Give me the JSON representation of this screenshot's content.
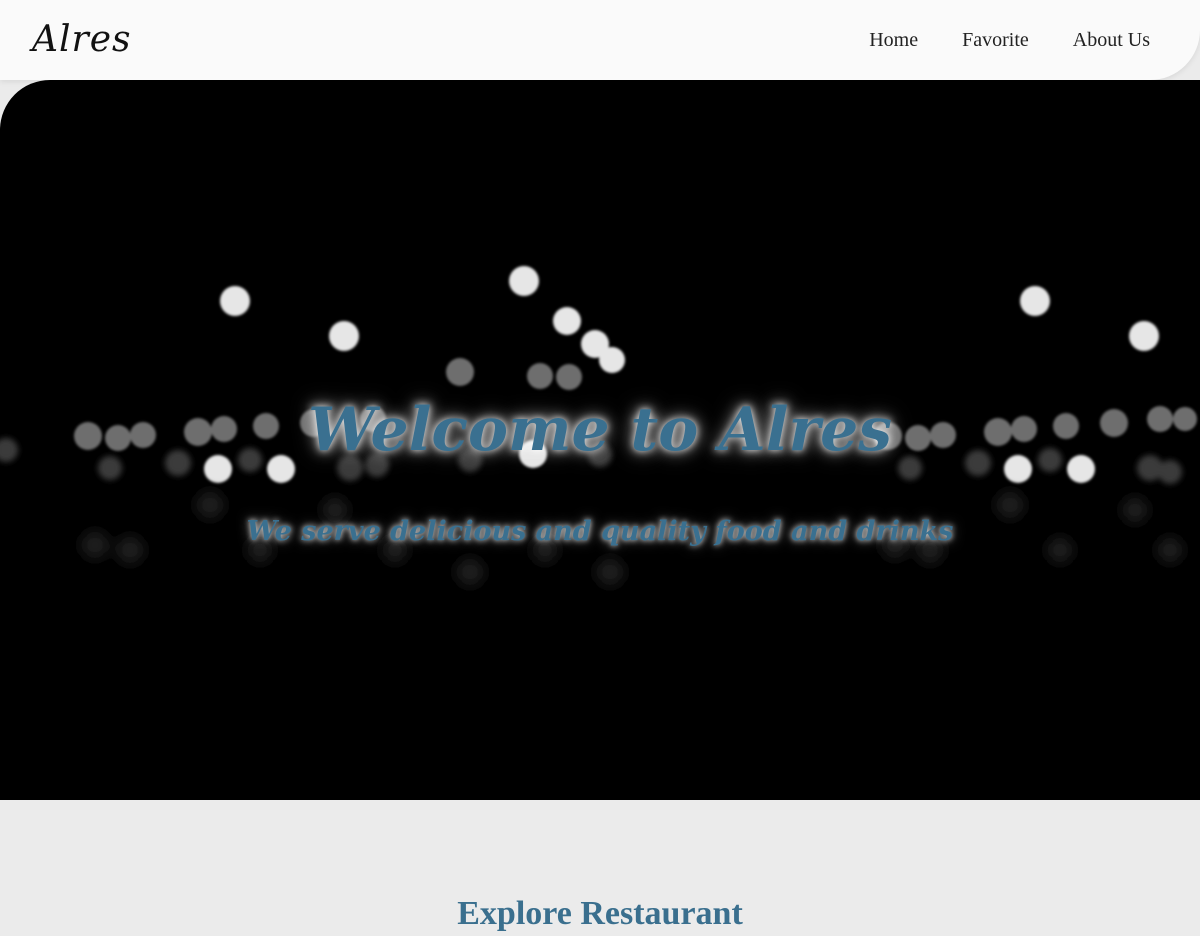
{
  "header": {
    "logo": "Alres",
    "nav": [
      {
        "label": "Home"
      },
      {
        "label": "Favorite"
      },
      {
        "label": "About Us"
      }
    ]
  },
  "hero": {
    "title": "Welcome to Alres",
    "subtitle": "We serve delicious and quality food and drinks"
  },
  "explore": {
    "title": "Explore Restaurant"
  },
  "colors": {
    "accent": "#3a7090",
    "header_bg": "#fafafa",
    "hero_bg": "#000000",
    "page_bg": "#ebebeb"
  }
}
